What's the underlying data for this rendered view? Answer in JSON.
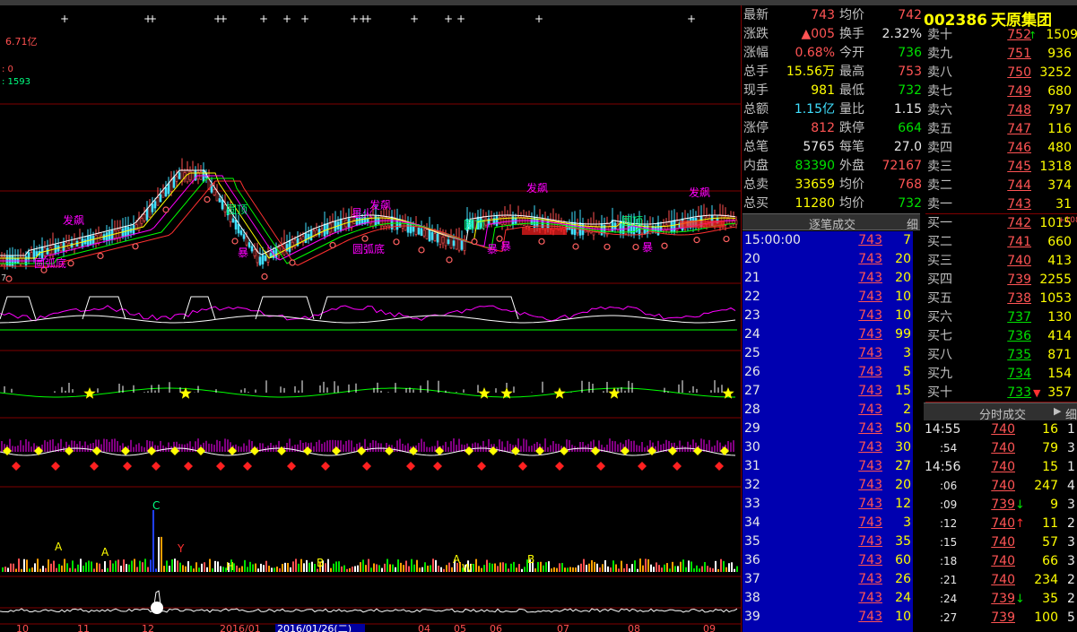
{
  "chart": {
    "top_stars": "+",
    "info_amount": "6.71亿",
    "info_a": ": 0",
    "info_b": ": 1593",
    "left_price_label": "7",
    "annotations": [
      {
        "text": "发飙",
        "color": "#ff00ff"
      },
      {
        "text": "圆弧底",
        "color": "#ff00ff"
      },
      {
        "text": "圆顶",
        "color": "#00ff80"
      },
      {
        "text": "星火",
        "color": "#ff00ff"
      },
      {
        "text": "发飙",
        "color": "#ff00ff"
      },
      {
        "text": "圆弧底",
        "color": "#ff00ff"
      },
      {
        "text": "圆顶",
        "color": "#00ff80"
      },
      {
        "text": "暴",
        "color": "#ff00ff"
      },
      {
        "text": "暴",
        "color": "#ff00ff"
      },
      {
        "text": "发飙",
        "color": "#ff00ff"
      },
      {
        "text": "圆顶",
        "color": "#00ff80"
      },
      {
        "text": "暴",
        "color": "#ff00ff"
      },
      {
        "text": "发飙",
        "color": "#ff00ff"
      },
      {
        "text": "暴",
        "color": "#ff00ff"
      }
    ],
    "x_axis": [
      "10",
      "11",
      "12",
      "2016/01",
      "2016/01/26(二)",
      "04",
      "05",
      "06",
      "07",
      "08",
      "09"
    ],
    "vol_labels": [
      "C",
      "A",
      "Y",
      "A",
      "H",
      "B",
      "A",
      "W",
      "B"
    ]
  },
  "quote": [
    {
      "l1": "最新",
      "v1": "743",
      "c1": "red",
      "l2": "均价",
      "v2": "742",
      "c2": "red"
    },
    {
      "l1": "涨跌",
      "v1": "▲005",
      "c1": "red",
      "l2": "换手",
      "v2": "2.32%",
      "c2": "white"
    },
    {
      "l1": "涨幅",
      "v1": "0.68%",
      "c1": "red",
      "l2": "今开",
      "v2": "736",
      "c2": "green"
    },
    {
      "l1": "总手",
      "v1": "15.56万",
      "c1": "yellow",
      "l2": "最高",
      "v2": "753",
      "c2": "red"
    },
    {
      "l1": "现手",
      "v1": "981",
      "c1": "yellow",
      "l2": "最低",
      "v2": "732",
      "c2": "green"
    },
    {
      "l1": "总额",
      "v1": "1.15亿",
      "c1": "cyan",
      "l2": "量比",
      "v2": "1.15",
      "c2": "white"
    },
    {
      "l1": "涨停",
      "v1": "812",
      "c1": "red",
      "l2": "跌停",
      "v2": "664",
      "c2": "green"
    },
    {
      "l1": "总笔",
      "v1": "5765",
      "c1": "white",
      "l2": "每笔",
      "v2": "27.0",
      "c2": "white"
    },
    {
      "l1": "内盘",
      "v1": "83390",
      "c1": "green",
      "l2": "外盘",
      "v2": "72167",
      "c2": "red"
    },
    {
      "l1": "总卖",
      "v1": "33659",
      "c1": "yellow",
      "l2": "均价",
      "v2": "768",
      "c2": "red"
    },
    {
      "l1": "总买",
      "v1": "11280",
      "c1": "yellow",
      "l2": "均价",
      "v2": "732",
      "c2": "green"
    }
  ],
  "stock": {
    "code": "002386",
    "name": "天原集团"
  },
  "order_book": {
    "asks": [
      {
        "label": "卖十",
        "price": "752",
        "vol": "1509",
        "pc": "red",
        "mark": "↑"
      },
      {
        "label": "卖九",
        "price": "751",
        "vol": "936",
        "pc": "red"
      },
      {
        "label": "卖八",
        "price": "750",
        "vol": "3252",
        "pc": "red"
      },
      {
        "label": "卖七",
        "price": "749",
        "vol": "680",
        "pc": "red"
      },
      {
        "label": "卖六",
        "price": "748",
        "vol": "797",
        "pc": "red"
      },
      {
        "label": "卖五",
        "price": "747",
        "vol": "116",
        "pc": "red"
      },
      {
        "label": "卖四",
        "price": "746",
        "vol": "480",
        "pc": "red"
      },
      {
        "label": "卖三",
        "price": "745",
        "vol": "1318",
        "pc": "red"
      },
      {
        "label": "卖二",
        "price": "744",
        "vol": "374",
        "pc": "red"
      },
      {
        "label": "卖一",
        "price": "743",
        "vol": "31",
        "pc": "red"
      }
    ],
    "bids": [
      {
        "label": "买一",
        "price": "742",
        "vol": "1015",
        "pc": "red",
        "extra": "+108"
      },
      {
        "label": "买二",
        "price": "741",
        "vol": "660",
        "pc": "red"
      },
      {
        "label": "买三",
        "price": "740",
        "vol": "413",
        "pc": "red"
      },
      {
        "label": "买四",
        "price": "739",
        "vol": "2255",
        "pc": "red"
      },
      {
        "label": "买五",
        "price": "738",
        "vol": "1053",
        "pc": "red"
      },
      {
        "label": "买六",
        "price": "737",
        "vol": "130",
        "pc": "green"
      },
      {
        "label": "买七",
        "price": "736",
        "vol": "414",
        "pc": "green"
      },
      {
        "label": "买八",
        "price": "735",
        "vol": "871",
        "pc": "green"
      },
      {
        "label": "买九",
        "price": "734",
        "vol": "154",
        "pc": "green"
      },
      {
        "label": "买十",
        "price": "733",
        "vol": "357",
        "pc": "green",
        "mark": "▼"
      }
    ]
  },
  "tick_panel": {
    "title": "逐笔成交",
    "side": "细",
    "rows": [
      {
        "time": "15:00:00",
        "price": "743",
        "vol": "7"
      },
      {
        "time": "20",
        "price": "743",
        "vol": "20"
      },
      {
        "time": "21",
        "price": "743",
        "vol": "20"
      },
      {
        "time": "22",
        "price": "743",
        "vol": "10"
      },
      {
        "time": "23",
        "price": "743",
        "vol": "10"
      },
      {
        "time": "24",
        "price": "743",
        "vol": "99"
      },
      {
        "time": "25",
        "price": "743",
        "vol": "3"
      },
      {
        "time": "26",
        "price": "743",
        "vol": "5"
      },
      {
        "time": "27",
        "price": "743",
        "vol": "15"
      },
      {
        "time": "28",
        "price": "743",
        "vol": "2"
      },
      {
        "time": "29",
        "price": "743",
        "vol": "50"
      },
      {
        "time": "30",
        "price": "743",
        "vol": "30"
      },
      {
        "time": "31",
        "price": "743",
        "vol": "27"
      },
      {
        "time": "32",
        "price": "743",
        "vol": "20"
      },
      {
        "time": "33",
        "price": "743",
        "vol": "12"
      },
      {
        "time": "34",
        "price": "743",
        "vol": "3"
      },
      {
        "time": "35",
        "price": "743",
        "vol": "35"
      },
      {
        "time": "36",
        "price": "743",
        "vol": "60"
      },
      {
        "time": "37",
        "price": "743",
        "vol": "26"
      },
      {
        "time": "38",
        "price": "743",
        "vol": "24"
      },
      {
        "time": "39",
        "price": "743",
        "vol": "10"
      }
    ]
  },
  "time_sales": {
    "title": "分时成交",
    "arrow": "▶",
    "side": "细",
    "rows": [
      {
        "time": "14:55",
        "price": "740",
        "vol": "16",
        "n": "1",
        "sub": false,
        "dir": ""
      },
      {
        "time": ":54",
        "price": "740",
        "vol": "79",
        "n": "3",
        "sub": true,
        "dir": ""
      },
      {
        "time": "14:56",
        "price": "740",
        "vol": "15",
        "n": "1",
        "sub": false,
        "dir": ""
      },
      {
        "time": ":06",
        "price": "740",
        "vol": "247",
        "n": "4",
        "sub": true,
        "dir": ""
      },
      {
        "time": ":09",
        "price": "739",
        "vol": "9",
        "n": "3",
        "sub": true,
        "dir": "↓"
      },
      {
        "time": ":12",
        "price": "740",
        "vol": "11",
        "n": "2",
        "sub": true,
        "dir": "↑"
      },
      {
        "time": ":15",
        "price": "740",
        "vol": "57",
        "n": "3",
        "sub": true,
        "dir": ""
      },
      {
        "time": ":18",
        "price": "740",
        "vol": "66",
        "n": "3",
        "sub": true,
        "dir": ""
      },
      {
        "time": ":21",
        "price": "740",
        "vol": "234",
        "n": "2",
        "sub": true,
        "dir": ""
      },
      {
        "time": ":24",
        "price": "739",
        "vol": "35",
        "n": "2",
        "sub": true,
        "dir": "↓"
      },
      {
        "time": ":27",
        "price": "739",
        "vol": "100",
        "n": "5",
        "sub": true,
        "dir": ""
      }
    ]
  }
}
